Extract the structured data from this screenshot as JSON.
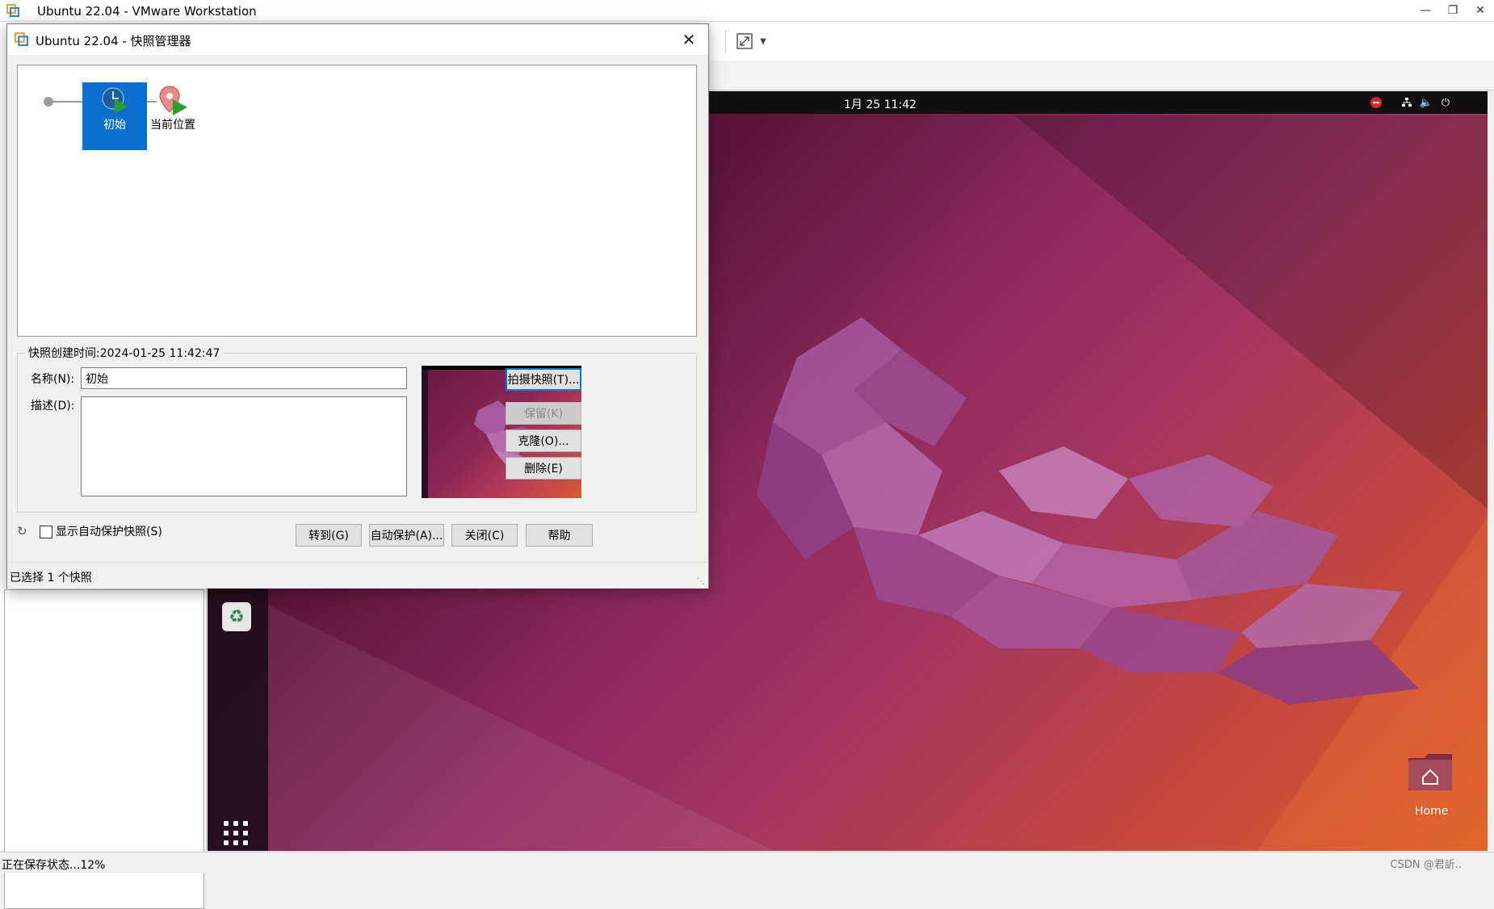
{
  "app": {
    "window_title": "Ubuntu 22.04 - VMware Workstation",
    "status_text": "正在保存状态...12%",
    "watermark": "CSDN @君訢.."
  },
  "guest": {
    "clock": "1月 25  11:42",
    "home_label": "Home"
  },
  "dialog": {
    "title": "Ubuntu 22.04 - 快照管理器",
    "snapshot_node_label": "初始",
    "current_position_label": "当前位置",
    "created_label": "快照创建时间:2024-01-25 11:42:47",
    "name_label": "名称(N):",
    "desc_label": "描述(D):",
    "name_value": "初始",
    "desc_value": "",
    "buttons": {
      "take_snapshot": "拍摄快照(T)...",
      "keep": "保留(K)",
      "clone": "克隆(O)...",
      "delete": "删除(E)",
      "goto": "转到(G)",
      "autoprotect": "自动保护(A)...",
      "close": "关闭(C)",
      "help": "帮助"
    },
    "show_autoprotect_label": "显示自动保护快照(S)",
    "show_autoprotect_checked": false,
    "status": "已选择 1 个快照"
  },
  "colors": {
    "selection_blue": "#0a6fd1",
    "default_button_border": "#0078d7"
  }
}
